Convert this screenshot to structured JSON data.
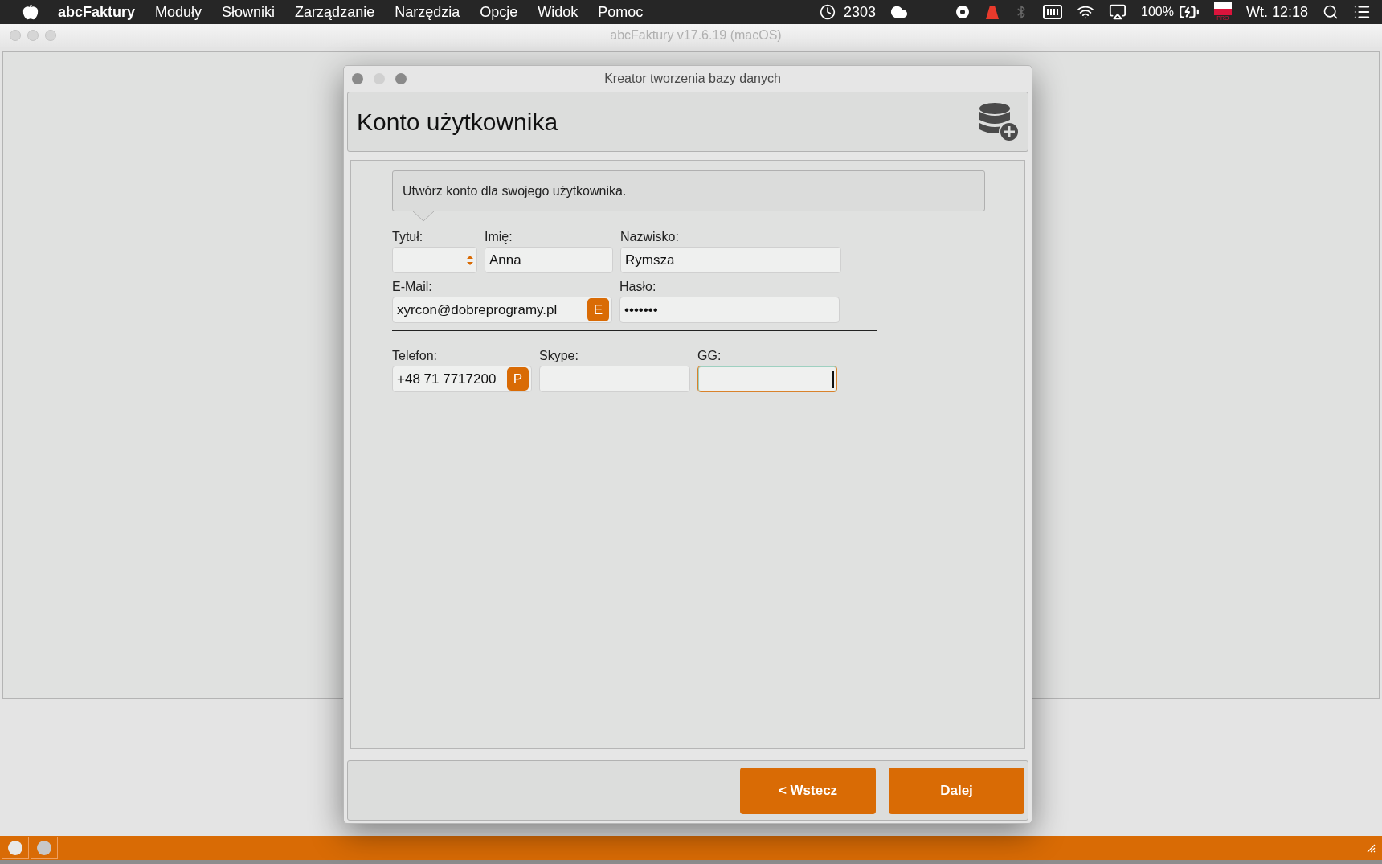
{
  "menu_bar": {
    "app_name": "abcFaktury",
    "items": [
      "Moduły",
      "Słowniki",
      "Zarządzanie",
      "Narzędzia",
      "Opcje",
      "Widok",
      "Pomoc"
    ],
    "status": {
      "counter": "2303",
      "battery": "100%",
      "flag_label": "PRO",
      "time": "Wt. 12:18"
    }
  },
  "main_window": {
    "title": "abcFaktury v17.6.19 (macOS)"
  },
  "dialog": {
    "title": "Kreator tworzenia bazy danych",
    "heading": "Konto użytkownika",
    "info": "Utwórz konto dla swojego użytkownika.",
    "sections": [
      {
        "lines": [
          {
            "fields": [
              {
                "label": "Tytuł:",
                "kind": "select",
                "focused": false
              },
              {
                "label": "Imię:",
                "kind": "text",
                "value": "Anna",
                "focused": false
              },
              {
                "label": "Nazwisko:",
                "kind": "text",
                "value": "Rymsza",
                "focused": false
              }
            ]
          },
          {
            "fields": [
              {
                "label": "E-Mail:",
                "kind": "text",
                "value": "xyrcon@dobreprogramy.pl",
                "badge": "E",
                "focused": false
              },
              {
                "label": "Hasło:",
                "kind": "password",
                "value": "•••••••",
                "focused": false
              }
            ]
          }
        ]
      },
      {
        "lines": [
          {
            "fields": [
              {
                "label": "Telefon:",
                "kind": "text",
                "value": "+48 71 7717200",
                "badge": "P",
                "focused": false
              },
              {
                "label": "Skype:",
                "kind": "text",
                "focused": false
              },
              {
                "label": "GG:",
                "kind": "text",
                "focused": true
              }
            ]
          }
        ]
      }
    ],
    "buttons": [
      "< Wstecz",
      "Dalej"
    ]
  }
}
